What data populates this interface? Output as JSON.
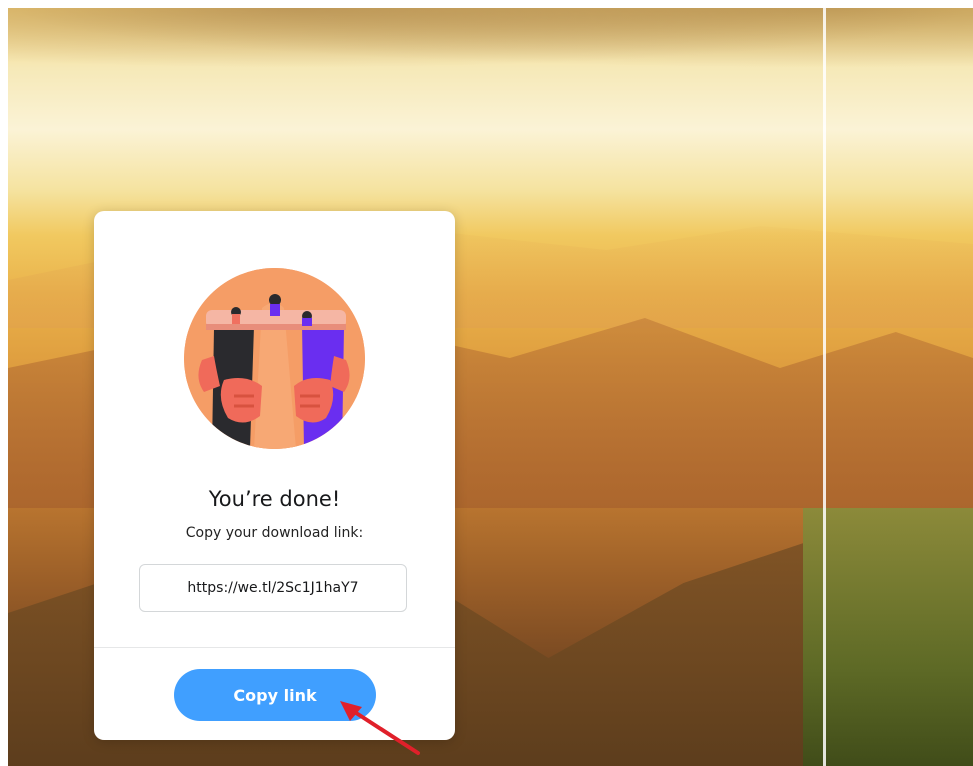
{
  "dialog": {
    "title": "You’re done!",
    "subtitle": "Copy your download link:",
    "link_value": "https://we.tl/2Sc1J1haY7",
    "copy_button_label": "Copy link"
  },
  "colors": {
    "button": "#409fff",
    "illustration_bg": "#f59d66",
    "annotation_arrow": "#e0202a"
  },
  "icons": {
    "illustration": "celebration-illustration",
    "annotation": "red-arrow-icon"
  }
}
